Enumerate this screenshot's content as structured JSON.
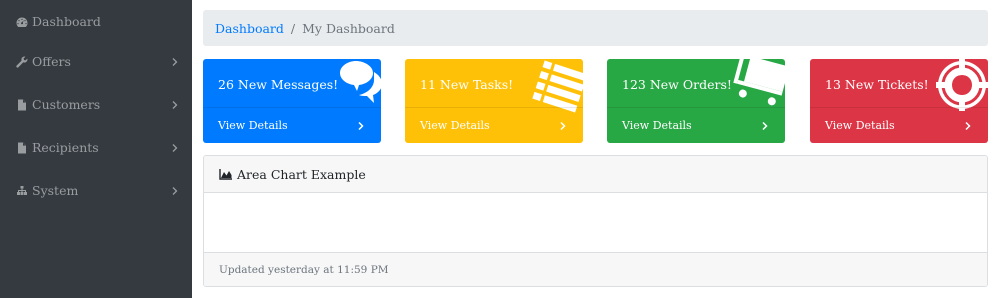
{
  "sidebar": {
    "items": [
      {
        "label": "Dashboard",
        "icon": "dashboard-icon",
        "has_submenu": false
      },
      {
        "label": "Offers",
        "icon": "wrench-icon",
        "has_submenu": true
      },
      {
        "label": "Customers",
        "icon": "file-icon",
        "has_submenu": true
      },
      {
        "label": "Recipients",
        "icon": "file-icon",
        "has_submenu": true
      },
      {
        "label": "System",
        "icon": "sitemap-icon",
        "has_submenu": true
      }
    ]
  },
  "breadcrumb": {
    "home": "Dashboard",
    "separator": "/",
    "current": "My Dashboard"
  },
  "cards": [
    {
      "title": "26 New Messages!",
      "footer": "View Details",
      "icon": "comments-icon",
      "color": "#007bff"
    },
    {
      "title": "11 New Tasks!",
      "footer": "View Details",
      "icon": "list-icon",
      "color": "#ffc107"
    },
    {
      "title": "123 New Orders!",
      "footer": "View Details",
      "icon": "shopping-cart-icon",
      "color": "#28a745"
    },
    {
      "title": "13 New Tickets!",
      "footer": "View Details",
      "icon": "life-ring-icon",
      "color": "#dc3545"
    }
  ],
  "chart_panel": {
    "title": "Area Chart Example",
    "icon": "area-chart-icon",
    "footer": "Updated yesterday at 11:59 PM"
  },
  "colors": {
    "sidebar_bg": "#343a40",
    "sidebar_text": "#9a9da0",
    "link": "#007bff",
    "breadcrumb_bg": "#e9ecef"
  }
}
